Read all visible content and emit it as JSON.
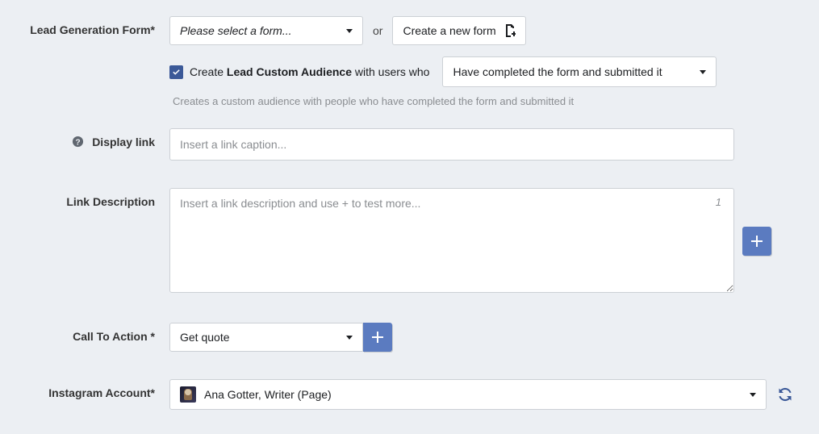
{
  "leadForm": {
    "label": "Lead Generation Form*",
    "selectPlaceholder": "Please select a form...",
    "orText": "or",
    "createButton": "Create a new form",
    "checkboxChecked": true,
    "checkboxPrefix": "Create ",
    "checkboxBold": "Lead Custom Audience",
    "checkboxSuffix": " with users who",
    "audienceOption": "Have completed the form and submitted it",
    "helper": "Creates a custom audience with people who have completed the form and submitted it"
  },
  "displayLink": {
    "label": "Display link",
    "placeholder": "Insert a link caption..."
  },
  "linkDescription": {
    "label": "Link Description",
    "placeholder": "Insert a link description and use + to test more...",
    "counter": "1"
  },
  "cta": {
    "label": "Call To Action *",
    "value": "Get quote"
  },
  "instagram": {
    "label": "Instagram Account*",
    "value": "Ana Gotter, Writer (Page)"
  }
}
